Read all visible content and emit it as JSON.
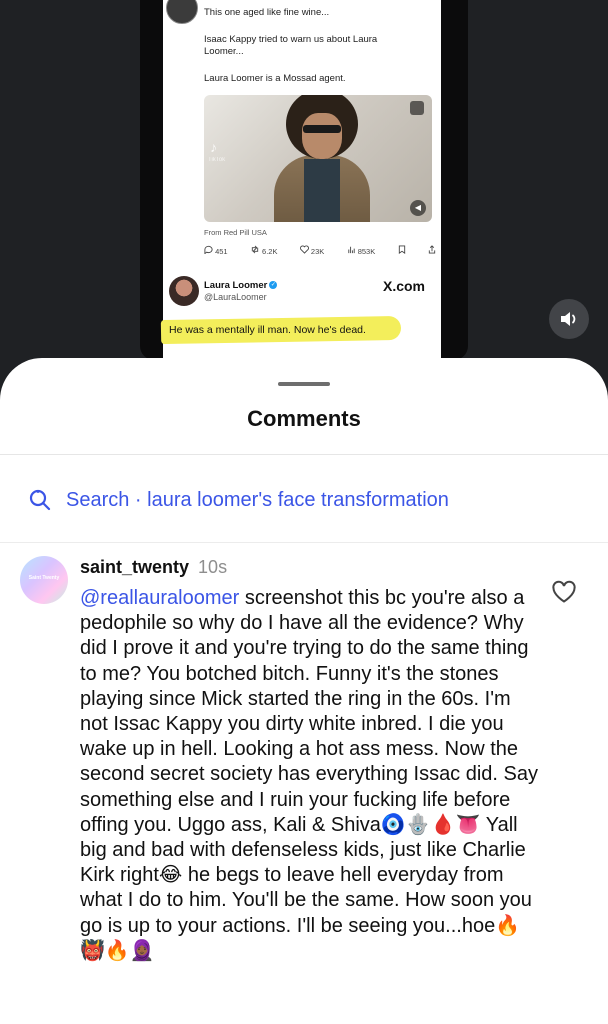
{
  "video": {
    "quote_line_1": "This one aged like fine wine...",
    "quote_line_2": "Isaac Kappy tried to warn us about Laura Loomer...",
    "quote_line_3": "Laura Loomer is a Mossad agent.",
    "media_watermark": "TikTok",
    "from_line": "From Red Pill USA",
    "stats": {
      "replies": "451",
      "reposts": "6.2K",
      "likes": "23K",
      "views": "853K"
    },
    "author_name": "Laura Loomer",
    "author_handle": "@LauraLoomer",
    "source_site": "X.com",
    "highlighted_quote": "He was a mentally ill man. Now he's dead.",
    "highlight_color": "#f3ee5b"
  },
  "comments_sheet": {
    "title": "Comments",
    "search_prefix": "Search · ",
    "search_query": "laura loomer's face transformation",
    "accent_color": "#3b55e6"
  },
  "comment": {
    "username": "saint_twenty",
    "timestamp": "10s",
    "avatar_text": "Saint Twenty",
    "mention": "@reallauraloomer",
    "text": " screenshot this bc you're also a pedophile so why do I have all the evidence? Why did I prove it and you're trying to do the same thing to me? You botched bitch. Funny it's the stones playing since Mick started the ring in the 60s. I'm not Issac Kappy you dirty white inbred. I die you wake up in hell. Looking a hot ass mess. Now the second secret society has everything Issac did. Say something else and I ruin your fucking life before offing you. Uggo ass, Kali & Shiva🧿🪬🩸👅 Yall big and bad with defenseless kids, just like Charlie Kirk right😂 he begs to leave hell everyday from what I do to him. You'll be the same. How soon you go is up to your actions. I'll be seeing you...hoe🔥👹🔥🧕🏾"
  }
}
